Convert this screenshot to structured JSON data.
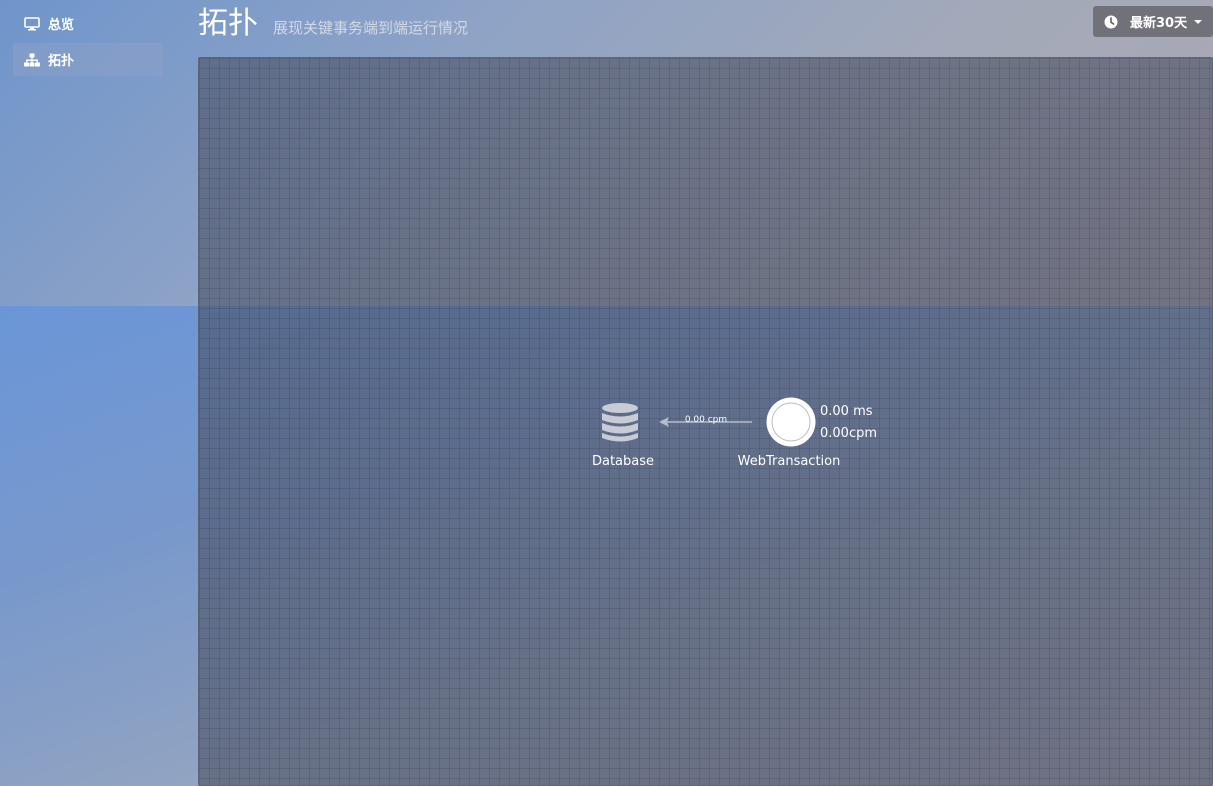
{
  "sidebar": {
    "items": [
      {
        "label": "总览",
        "icon": "monitor-icon",
        "active": false
      },
      {
        "label": "拓扑",
        "icon": "sitemap-icon",
        "active": true
      }
    ]
  },
  "header": {
    "title": "拓扑",
    "subtitle": "展现关键事务端到端运行情况"
  },
  "time_range": {
    "label": "最新30天",
    "icon": "clock-icon"
  },
  "topology": {
    "nodes": [
      {
        "id": "database",
        "label": "Database",
        "icon": "database-icon"
      },
      {
        "id": "web",
        "label": "WebTransaction",
        "icon": "circle-node-icon",
        "response_time": "0.00 ms",
        "throughput": "0.00cpm"
      }
    ],
    "edges": [
      {
        "from": "web",
        "to": "database",
        "label": "0.00 cpm"
      }
    ]
  }
}
